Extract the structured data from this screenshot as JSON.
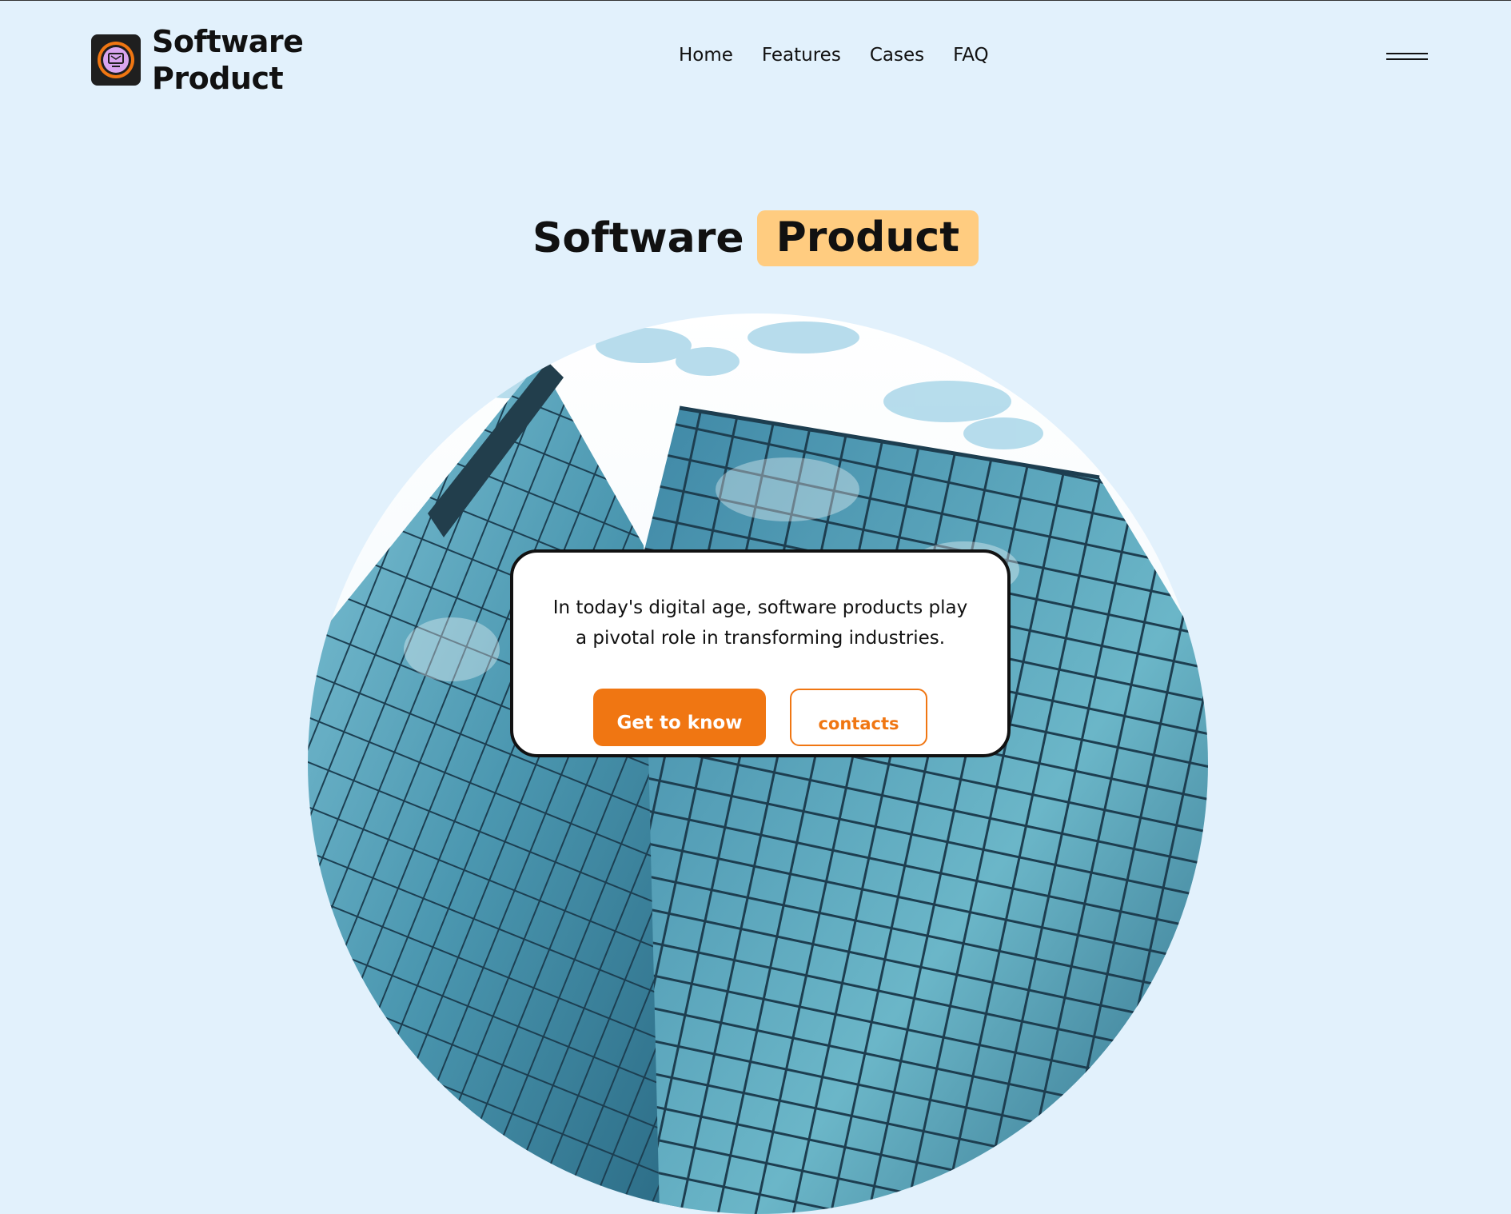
{
  "brand": {
    "name_line1": "Software",
    "name_line2": "Product"
  },
  "nav": {
    "items": [
      "Home",
      "Features",
      "Cases",
      "FAQ"
    ]
  },
  "hero": {
    "title_part1": "Software",
    "title_part2": "Product",
    "description": "In today's digital age, software products play a pivotal role in transforming industries.",
    "primary_button": "Get to know",
    "secondary_button": "contacts"
  },
  "colors": {
    "background": "#e2f1fc",
    "accent": "#f07612",
    "highlight": "#ffcc80",
    "logo_ring": "#f07612",
    "logo_inner": "#d9a6f0"
  }
}
